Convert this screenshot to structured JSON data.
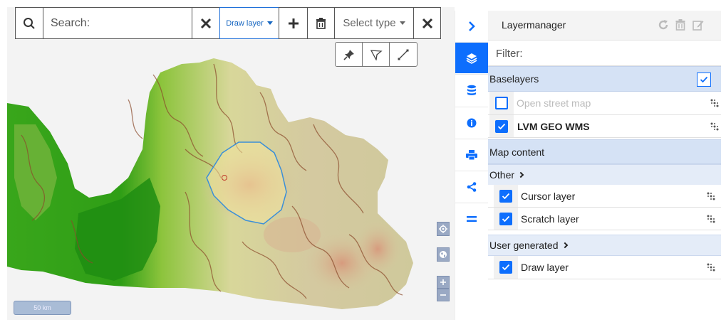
{
  "toolbar": {
    "search_placeholder": "Search:",
    "draw_layer_label": "Draw layer",
    "select_type_label": "Select type"
  },
  "map": {
    "scale_label": "50 km"
  },
  "layer_manager": {
    "title": "Layermanager",
    "filter_placeholder": "Filter:",
    "baselayers": {
      "title": "Baselayers",
      "items": [
        {
          "label": "Open street map",
          "checked": false
        },
        {
          "label": "LVM GEO WMS",
          "checked": true
        }
      ]
    },
    "map_content": {
      "title": "Map content",
      "groups": [
        {
          "title": "Other",
          "items": [
            {
              "label": "Cursor layer",
              "checked": true
            },
            {
              "label": "Scratch layer",
              "checked": true
            }
          ]
        },
        {
          "title": "User generated",
          "items": [
            {
              "label": "Draw layer",
              "checked": true
            }
          ]
        }
      ]
    }
  },
  "colors": {
    "accent": "#0d6efd",
    "section_bg": "#d5e2f5",
    "drawn_polygon": "#3b8fd8"
  }
}
